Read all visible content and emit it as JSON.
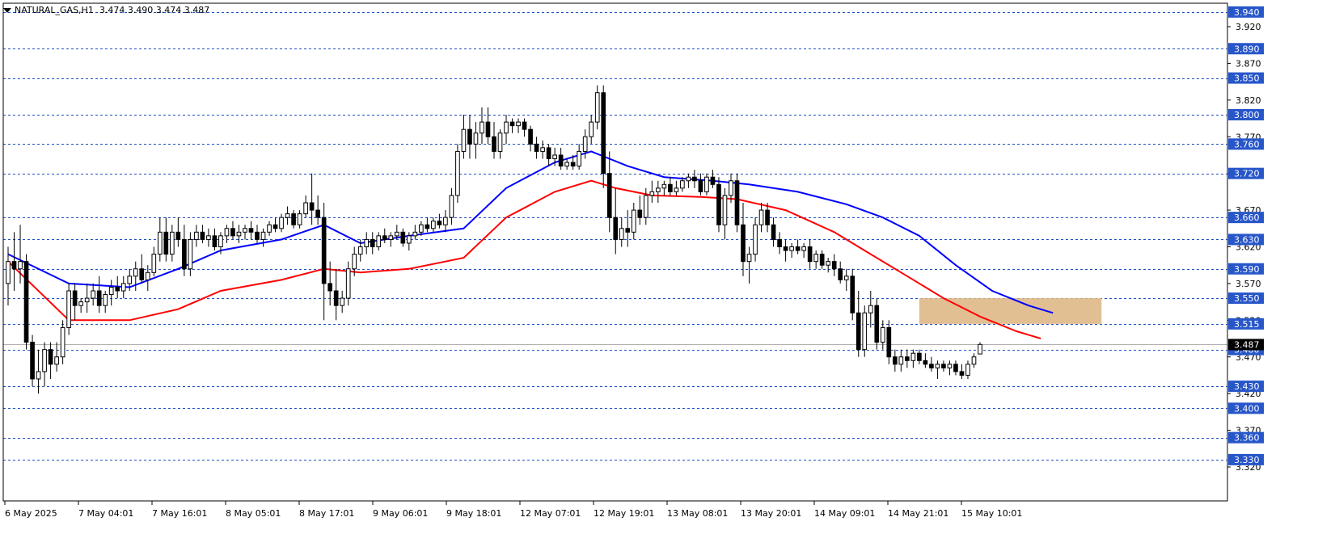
{
  "header": {
    "symbol": "NATURAL_GAS,H1",
    "ohlc": "3.474 3.490 3.474 3.487"
  },
  "colors": {
    "candle_up": "#ffffff",
    "candle_down": "#000000",
    "ma_fast": "#ff0000",
    "ma_slow": "#0000ff",
    "level_line": "#1f4fbf",
    "level_label_bg": "#2756c9",
    "zone_fill": "#deb887",
    "current_price_bg": "#000000"
  },
  "chart_data": {
    "type": "candlestick",
    "symbol": "NATURAL_GAS",
    "timeframe": "H1",
    "ylim": [
      3.3,
      3.95
    ],
    "y_ticks": [
      "3.920",
      "3.870",
      "3.820",
      "3.770",
      "3.720",
      "3.670",
      "3.620",
      "3.570",
      "3.520",
      "3.470",
      "3.420",
      "3.370",
      "3.320"
    ],
    "x_labels": [
      "6 May 2025",
      "7 May 04:01",
      "7 May 16:01",
      "8 May 05:01",
      "8 May 17:01",
      "9 May 06:01",
      "9 May 18:01",
      "12 May 07:01",
      "12 May 19:01",
      "13 May 08:01",
      "13 May 20:01",
      "14 May 09:01",
      "14 May 21:01",
      "15 May 10:01"
    ],
    "levels": [
      "3.940",
      "3.890",
      "3.850",
      "3.800",
      "3.760",
      "3.720",
      "3.660",
      "3.630",
      "3.590",
      "3.550",
      "3.515",
      "3.480",
      "3.430",
      "3.400",
      "3.360",
      "3.330"
    ],
    "current_price": "3.487",
    "zone": {
      "from_bar": 150,
      "to_bar": 180,
      "low": 3.515,
      "high": 3.55
    },
    "ohlc": [
      [
        3.57,
        3.62,
        3.54,
        3.6
      ],
      [
        3.6,
        3.64,
        3.56,
        3.59
      ],
      [
        3.59,
        3.65,
        3.57,
        3.6
      ],
      [
        3.6,
        3.61,
        3.48,
        3.49
      ],
      [
        3.49,
        3.5,
        3.43,
        3.44
      ],
      [
        3.44,
        3.48,
        3.42,
        3.45
      ],
      [
        3.45,
        3.49,
        3.43,
        3.48
      ],
      [
        3.48,
        3.49,
        3.44,
        3.46
      ],
      [
        3.46,
        3.49,
        3.45,
        3.47
      ],
      [
        3.47,
        3.52,
        3.46,
        3.51
      ],
      [
        3.51,
        3.57,
        3.5,
        3.56
      ],
      [
        3.56,
        3.57,
        3.52,
        3.54
      ],
      [
        3.54,
        3.55,
        3.53,
        3.545
      ],
      [
        3.545,
        3.57,
        3.53,
        3.55
      ],
      [
        3.55,
        3.57,
        3.54,
        3.56
      ],
      [
        3.56,
        3.58,
        3.53,
        3.54
      ],
      [
        3.54,
        3.56,
        3.53,
        3.555
      ],
      [
        3.555,
        3.575,
        3.54,
        3.565
      ],
      [
        3.565,
        3.58,
        3.55,
        3.56
      ],
      [
        3.56,
        3.58,
        3.55,
        3.57
      ],
      [
        3.57,
        3.59,
        3.56,
        3.58
      ],
      [
        3.58,
        3.6,
        3.56,
        3.59
      ],
      [
        3.59,
        3.61,
        3.57,
        3.575
      ],
      [
        3.575,
        3.595,
        3.56,
        3.585
      ],
      [
        3.585,
        3.62,
        3.58,
        3.61
      ],
      [
        3.61,
        3.66,
        3.6,
        3.64
      ],
      [
        3.64,
        3.66,
        3.6,
        3.61
      ],
      [
        3.61,
        3.65,
        3.6,
        3.64
      ],
      [
        3.64,
        3.66,
        3.62,
        3.63
      ],
      [
        3.63,
        3.65,
        3.58,
        3.59
      ],
      [
        3.59,
        3.64,
        3.58,
        3.63
      ],
      [
        3.63,
        3.65,
        3.62,
        3.64
      ],
      [
        3.64,
        3.65,
        3.625,
        3.63
      ],
      [
        3.63,
        3.645,
        3.62,
        3.635
      ],
      [
        3.635,
        3.645,
        3.615,
        3.62
      ],
      [
        3.62,
        3.64,
        3.61,
        3.635
      ],
      [
        3.635,
        3.65,
        3.625,
        3.645
      ],
      [
        3.645,
        3.655,
        3.63,
        3.635
      ],
      [
        3.635,
        3.65,
        3.625,
        3.64
      ],
      [
        3.64,
        3.65,
        3.63,
        3.645
      ],
      [
        3.645,
        3.655,
        3.63,
        3.64
      ],
      [
        3.64,
        3.65,
        3.625,
        3.63
      ],
      [
        3.63,
        3.645,
        3.62,
        3.64
      ],
      [
        3.64,
        3.655,
        3.635,
        3.65
      ],
      [
        3.65,
        3.66,
        3.64,
        3.645
      ],
      [
        3.645,
        3.665,
        3.64,
        3.66
      ],
      [
        3.66,
        3.675,
        3.65,
        3.665
      ],
      [
        3.665,
        3.67,
        3.645,
        3.65
      ],
      [
        3.65,
        3.67,
        3.645,
        3.665
      ],
      [
        3.665,
        3.69,
        3.66,
        3.68
      ],
      [
        3.68,
        3.72,
        3.65,
        3.67
      ],
      [
        3.67,
        3.69,
        3.65,
        3.66
      ],
      [
        3.66,
        3.68,
        3.52,
        3.57
      ],
      [
        3.57,
        3.6,
        3.54,
        3.56
      ],
      [
        3.56,
        3.59,
        3.52,
        3.54
      ],
      [
        3.54,
        3.56,
        3.53,
        3.55
      ],
      [
        3.55,
        3.6,
        3.54,
        3.59
      ],
      [
        3.59,
        3.62,
        3.58,
        3.61
      ],
      [
        3.61,
        3.63,
        3.6,
        3.62
      ],
      [
        3.62,
        3.64,
        3.61,
        3.63
      ],
      [
        3.63,
        3.64,
        3.61,
        3.62
      ],
      [
        3.62,
        3.64,
        3.615,
        3.635
      ],
      [
        3.635,
        3.645,
        3.625,
        3.63
      ],
      [
        3.63,
        3.64,
        3.62,
        3.635
      ],
      [
        3.635,
        3.65,
        3.63,
        3.64
      ],
      [
        3.64,
        3.645,
        3.62,
        3.625
      ],
      [
        3.625,
        3.64,
        3.615,
        3.635
      ],
      [
        3.635,
        3.65,
        3.63,
        3.64
      ],
      [
        3.64,
        3.655,
        3.635,
        3.65
      ],
      [
        3.65,
        3.66,
        3.64,
        3.645
      ],
      [
        3.645,
        3.66,
        3.64,
        3.655
      ],
      [
        3.655,
        3.665,
        3.645,
        3.65
      ],
      [
        3.65,
        3.67,
        3.64,
        3.66
      ],
      [
        3.66,
        3.7,
        3.65,
        3.69
      ],
      [
        3.69,
        3.76,
        3.68,
        3.75
      ],
      [
        3.75,
        3.8,
        3.74,
        3.78
      ],
      [
        3.78,
        3.8,
        3.74,
        3.76
      ],
      [
        3.76,
        3.79,
        3.74,
        3.775
      ],
      [
        3.775,
        3.81,
        3.76,
        3.79
      ],
      [
        3.79,
        3.81,
        3.76,
        3.77
      ],
      [
        3.77,
        3.79,
        3.74,
        3.75
      ],
      [
        3.75,
        3.78,
        3.74,
        3.775
      ],
      [
        3.775,
        3.8,
        3.76,
        3.79
      ],
      [
        3.79,
        3.795,
        3.775,
        3.785
      ],
      [
        3.785,
        3.795,
        3.775,
        3.79
      ],
      [
        3.79,
        3.795,
        3.77,
        3.78
      ],
      [
        3.78,
        3.785,
        3.75,
        3.76
      ],
      [
        3.76,
        3.77,
        3.74,
        3.75
      ],
      [
        3.75,
        3.765,
        3.74,
        3.755
      ],
      [
        3.755,
        3.76,
        3.73,
        3.74
      ],
      [
        3.74,
        3.755,
        3.73,
        3.745
      ],
      [
        3.745,
        3.755,
        3.725,
        3.73
      ],
      [
        3.73,
        3.74,
        3.725,
        3.735
      ],
      [
        3.735,
        3.745,
        3.725,
        3.73
      ],
      [
        3.73,
        3.76,
        3.725,
        3.75
      ],
      [
        3.75,
        3.78,
        3.74,
        3.77
      ],
      [
        3.77,
        3.8,
        3.76,
        3.79
      ],
      [
        3.79,
        3.84,
        3.78,
        3.83
      ],
      [
        3.83,
        3.84,
        3.7,
        3.72
      ],
      [
        3.72,
        3.75,
        3.64,
        3.66
      ],
      [
        3.66,
        3.7,
        3.61,
        3.63
      ],
      [
        3.63,
        3.66,
        3.62,
        3.645
      ],
      [
        3.645,
        3.67,
        3.62,
        3.64
      ],
      [
        3.64,
        3.68,
        3.63,
        3.67
      ],
      [
        3.67,
        3.69,
        3.65,
        3.66
      ],
      [
        3.66,
        3.7,
        3.65,
        3.69
      ],
      [
        3.69,
        3.71,
        3.68,
        3.695
      ],
      [
        3.695,
        3.71,
        3.68,
        3.7
      ],
      [
        3.7,
        3.71,
        3.69,
        3.705
      ],
      [
        3.705,
        3.715,
        3.69,
        3.695
      ],
      [
        3.695,
        3.71,
        3.69,
        3.7
      ],
      [
        3.7,
        3.715,
        3.695,
        3.71
      ],
      [
        3.71,
        3.72,
        3.7,
        3.715
      ],
      [
        3.715,
        3.725,
        3.7,
        3.71
      ],
      [
        3.71,
        3.72,
        3.69,
        3.695
      ],
      [
        3.695,
        3.72,
        3.69,
        3.715
      ],
      [
        3.715,
        3.725,
        3.7,
        3.705
      ],
      [
        3.705,
        3.715,
        3.64,
        3.65
      ],
      [
        3.65,
        3.7,
        3.63,
        3.69
      ],
      [
        3.69,
        3.72,
        3.68,
        3.71
      ],
      [
        3.71,
        3.72,
        3.64,
        3.65
      ],
      [
        3.65,
        3.68,
        3.58,
        3.6
      ],
      [
        3.6,
        3.62,
        3.57,
        3.61
      ],
      [
        3.61,
        3.66,
        3.6,
        3.65
      ],
      [
        3.65,
        3.68,
        3.64,
        3.67
      ],
      [
        3.67,
        3.68,
        3.64,
        3.65
      ],
      [
        3.65,
        3.66,
        3.62,
        3.63
      ],
      [
        3.63,
        3.64,
        3.61,
        3.62
      ],
      [
        3.62,
        3.63,
        3.6,
        3.615
      ],
      [
        3.615,
        3.625,
        3.605,
        3.62
      ],
      [
        3.62,
        3.63,
        3.61,
        3.615
      ],
      [
        3.615,
        3.625,
        3.605,
        3.62
      ],
      [
        3.62,
        3.63,
        3.59,
        3.6
      ],
      [
        3.6,
        3.615,
        3.59,
        3.61
      ],
      [
        3.61,
        3.615,
        3.59,
        3.595
      ],
      [
        3.595,
        3.605,
        3.585,
        3.6
      ],
      [
        3.6,
        3.61,
        3.58,
        3.59
      ],
      [
        3.59,
        3.6,
        3.57,
        3.575
      ],
      [
        3.575,
        3.59,
        3.56,
        3.58
      ],
      [
        3.58,
        3.59,
        3.52,
        3.53
      ],
      [
        3.53,
        3.56,
        3.47,
        3.48
      ],
      [
        3.48,
        3.54,
        3.47,
        3.53
      ],
      [
        3.53,
        3.56,
        3.51,
        3.54
      ],
      [
        3.54,
        3.55,
        3.48,
        3.49
      ],
      [
        3.49,
        3.52,
        3.48,
        3.51
      ],
      [
        3.51,
        3.52,
        3.46,
        3.47
      ],
      [
        3.47,
        3.48,
        3.45,
        3.46
      ],
      [
        3.46,
        3.48,
        3.45,
        3.47
      ],
      [
        3.47,
        3.48,
        3.455,
        3.465
      ],
      [
        3.465,
        3.48,
        3.455,
        3.475
      ],
      [
        3.475,
        3.48,
        3.46,
        3.465
      ],
      [
        3.465,
        3.475,
        3.455,
        3.46
      ],
      [
        3.46,
        3.47,
        3.45,
        3.455
      ],
      [
        3.455,
        3.465,
        3.44,
        3.46
      ],
      [
        3.46,
        3.465,
        3.45,
        3.455
      ],
      [
        3.455,
        3.465,
        3.445,
        3.46
      ],
      [
        3.46,
        3.465,
        3.445,
        3.45
      ],
      [
        3.45,
        3.46,
        3.44,
        3.445
      ],
      [
        3.445,
        3.465,
        3.44,
        3.46
      ],
      [
        3.46,
        3.475,
        3.455,
        3.47
      ],
      [
        3.474,
        3.49,
        3.474,
        3.487
      ]
    ],
    "ma_fast": [
      [
        0,
        3.6
      ],
      [
        10,
        3.52
      ],
      [
        20,
        3.52
      ],
      [
        28,
        3.535
      ],
      [
        35,
        3.56
      ],
      [
        45,
        3.575
      ],
      [
        52,
        3.59
      ],
      [
        58,
        3.585
      ],
      [
        66,
        3.59
      ],
      [
        75,
        3.605
      ],
      [
        82,
        3.66
      ],
      [
        90,
        3.695
      ],
      [
        96,
        3.71
      ],
      [
        100,
        3.7
      ],
      [
        106,
        3.69
      ],
      [
        114,
        3.688
      ],
      [
        120,
        3.685
      ],
      [
        128,
        3.67
      ],
      [
        136,
        3.64
      ],
      [
        142,
        3.61
      ],
      [
        148,
        3.58
      ],
      [
        154,
        3.55
      ],
      [
        160,
        3.525
      ],
      [
        166,
        3.505
      ],
      [
        170,
        3.495
      ]
    ],
    "ma_slow": [
      [
        0,
        3.61
      ],
      [
        10,
        3.57
      ],
      [
        20,
        3.565
      ],
      [
        28,
        3.59
      ],
      [
        35,
        3.615
      ],
      [
        45,
        3.63
      ],
      [
        52,
        3.65
      ],
      [
        58,
        3.625
      ],
      [
        66,
        3.635
      ],
      [
        75,
        3.645
      ],
      [
        82,
        3.7
      ],
      [
        90,
        3.735
      ],
      [
        96,
        3.75
      ],
      [
        102,
        3.73
      ],
      [
        108,
        3.715
      ],
      [
        116,
        3.71
      ],
      [
        122,
        3.705
      ],
      [
        130,
        3.695
      ],
      [
        138,
        3.678
      ],
      [
        144,
        3.66
      ],
      [
        150,
        3.635
      ],
      [
        156,
        3.595
      ],
      [
        162,
        3.56
      ],
      [
        168,
        3.54
      ],
      [
        172,
        3.53
      ]
    ]
  }
}
